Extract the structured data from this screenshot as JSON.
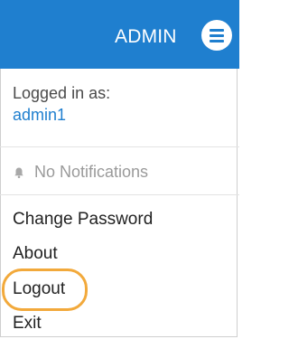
{
  "header": {
    "title": "ADMIN",
    "menu_icon": "hamburger-menu-icon",
    "background_color": "#1f7fcf"
  },
  "session": {
    "label": "Logged in as:",
    "username": "admin1"
  },
  "notifications": {
    "icon": "bell-icon",
    "text": "No Notifications"
  },
  "menu": {
    "items": [
      {
        "label": "Change Password"
      },
      {
        "label": "About"
      },
      {
        "label": "Logout"
      },
      {
        "label": "Exit"
      }
    ]
  },
  "highlight": {
    "target": "Logout",
    "color": "#f2a93b"
  }
}
